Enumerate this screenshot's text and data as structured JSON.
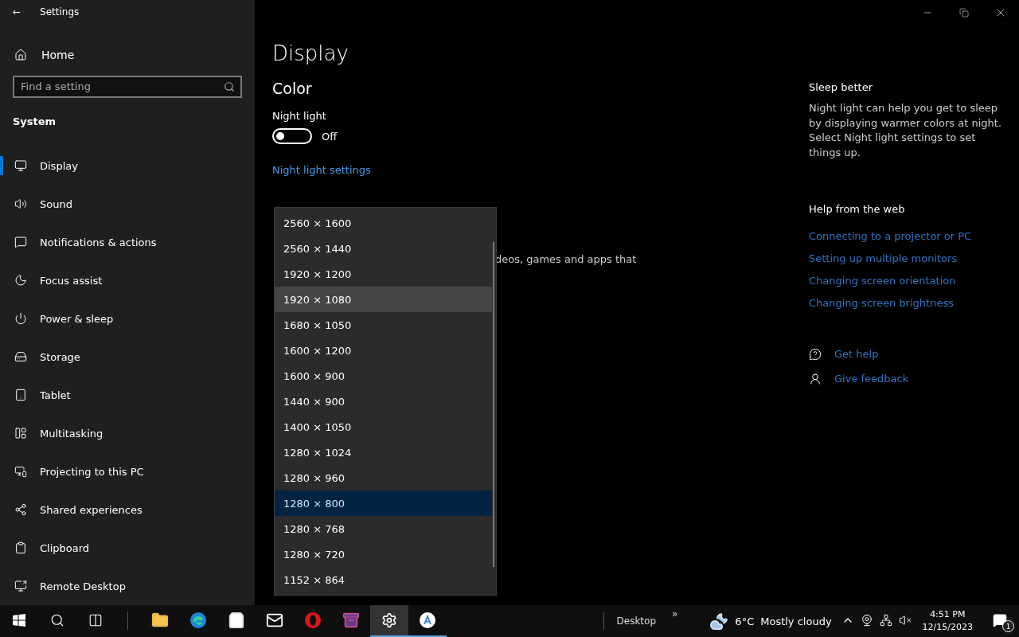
{
  "window": {
    "title": "Settings",
    "back": "←"
  },
  "sidebar": {
    "home": "Home",
    "search": {
      "placeholder": "Find a setting"
    },
    "section": "System",
    "items": [
      {
        "label": "Display",
        "selected": true
      },
      {
        "label": "Sound",
        "selected": false
      },
      {
        "label": "Notifications & actions",
        "selected": false
      },
      {
        "label": "Focus assist",
        "selected": false
      },
      {
        "label": "Power & sleep",
        "selected": false
      },
      {
        "label": "Storage",
        "selected": false
      },
      {
        "label": "Tablet",
        "selected": false
      },
      {
        "label": "Multitasking",
        "selected": false
      },
      {
        "label": "Projecting to this PC",
        "selected": false
      },
      {
        "label": "Shared experiences",
        "selected": false
      },
      {
        "label": "Clipboard",
        "selected": false
      },
      {
        "label": "Remote Desktop",
        "selected": false
      }
    ]
  },
  "main": {
    "title": "Display",
    "section": "Color",
    "night_light": {
      "label": "Night light",
      "on": false,
      "state": "Off"
    },
    "night_light_link": "Night light settings",
    "partial_text": "deos, games and apps that"
  },
  "resolution_dropdown": {
    "options": [
      {
        "label": "2560 × 1600",
        "selected": false,
        "hovered": false
      },
      {
        "label": "2560 × 1440",
        "selected": false,
        "hovered": false
      },
      {
        "label": "1920 × 1200",
        "selected": false,
        "hovered": false
      },
      {
        "label": "1920 × 1080",
        "selected": false,
        "hovered": true
      },
      {
        "label": "1680 × 1050",
        "selected": false,
        "hovered": false
      },
      {
        "label": "1600 × 1200",
        "selected": false,
        "hovered": false
      },
      {
        "label": "1600 × 900",
        "selected": false,
        "hovered": false
      },
      {
        "label": "1440 × 900",
        "selected": false,
        "hovered": false
      },
      {
        "label": "1400 × 1050",
        "selected": false,
        "hovered": false
      },
      {
        "label": "1280 × 1024",
        "selected": false,
        "hovered": false
      },
      {
        "label": "1280 × 960",
        "selected": false,
        "hovered": false
      },
      {
        "label": "1280 × 800",
        "selected": true,
        "hovered": false
      },
      {
        "label": "1280 × 768",
        "selected": false,
        "hovered": false
      },
      {
        "label": "1280 × 720",
        "selected": false,
        "hovered": false
      },
      {
        "label": "1152 × 864",
        "selected": false,
        "hovered": false
      }
    ]
  },
  "aside": {
    "sleep_title": "Sleep better",
    "sleep_text": "Night light can help you get to sleep by displaying warmer colors at night. Select Night light settings to set things up.",
    "help_title": "Help from the web",
    "help_links": [
      "Connecting to a projector or PC",
      "Setting up multiple monitors",
      "Changing screen orientation",
      "Changing screen brightness"
    ],
    "actions": [
      {
        "kind": "help",
        "label": "Get help"
      },
      {
        "kind": "feedback",
        "label": "Give feedback"
      }
    ]
  },
  "taskbar": {
    "apps": [
      {
        "kind": "explorer",
        "active": false,
        "running": false
      },
      {
        "kind": "edge",
        "active": false,
        "running": false
      },
      {
        "kind": "store",
        "active": false,
        "running": false
      },
      {
        "kind": "mail",
        "active": false,
        "running": false
      },
      {
        "kind": "opera",
        "active": false,
        "running": false
      },
      {
        "kind": "winrar",
        "active": false,
        "running": false
      },
      {
        "kind": "settings",
        "active": true,
        "running": true
      },
      {
        "kind": "app",
        "active": false,
        "running": true
      }
    ],
    "toolbar": "Desktop",
    "toolbar_more": "»",
    "weather": {
      "temp": "6°C",
      "text": "Mostly cloudy"
    },
    "time": "4:51 PM",
    "date": "12/15/2023",
    "notifications": "1"
  }
}
